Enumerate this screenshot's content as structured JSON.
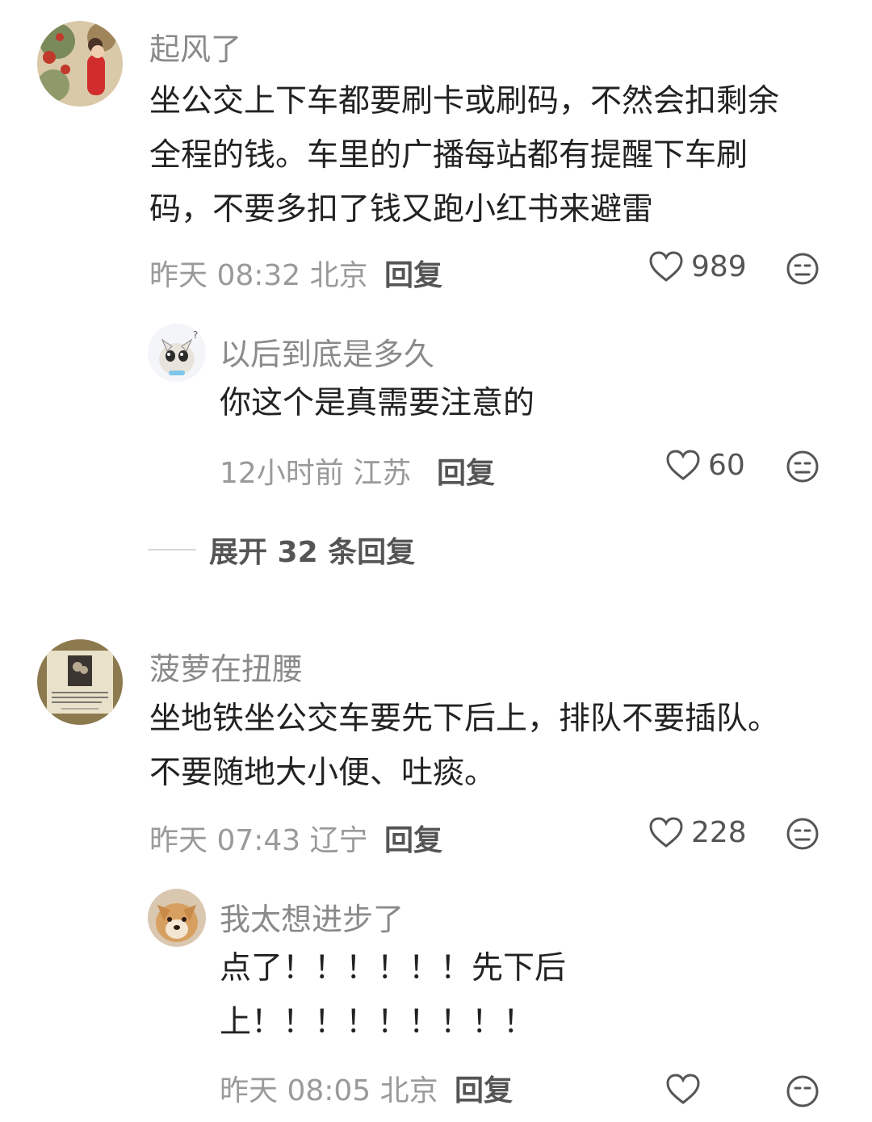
{
  "comments": [
    {
      "username": "起风了",
      "lines": [
        "坐公交上下车都要刷卡或刷码，不然会扣剩余",
        "全程的钱。车里的广播每站都有提醒下车刷",
        "码，不要多扣了钱又跑小红书来避雷"
      ],
      "time_location": "昨天 08:32 北京",
      "reply_label": "回复",
      "likes": "989",
      "replies": [
        {
          "username": "以后到底是多久",
          "lines": [
            "你这个是真需要注意的"
          ],
          "time_location": "12小时前 江苏",
          "reply_label": "回复",
          "likes": "60"
        }
      ],
      "expand_label": "展开 32 条回复"
    },
    {
      "username": "菠萝在扭腰",
      "lines": [
        "坐地铁坐公交车要先下后上，排队不要插队。",
        "不要随地大小便、吐痰。"
      ],
      "time_location": "昨天 07:43 辽宁",
      "reply_label": "回复",
      "likes": "228",
      "replies": [
        {
          "username": "我太想进步了",
          "lines": [
            "点了！！！！！！先下后",
            "上！！！！！！！！！"
          ],
          "time_location": "昨天 08:05 北京",
          "reply_label": "回复"
        }
      ]
    }
  ],
  "icons": {
    "like": "heart-outline-icon",
    "dislike": "neutral-face-icon"
  }
}
